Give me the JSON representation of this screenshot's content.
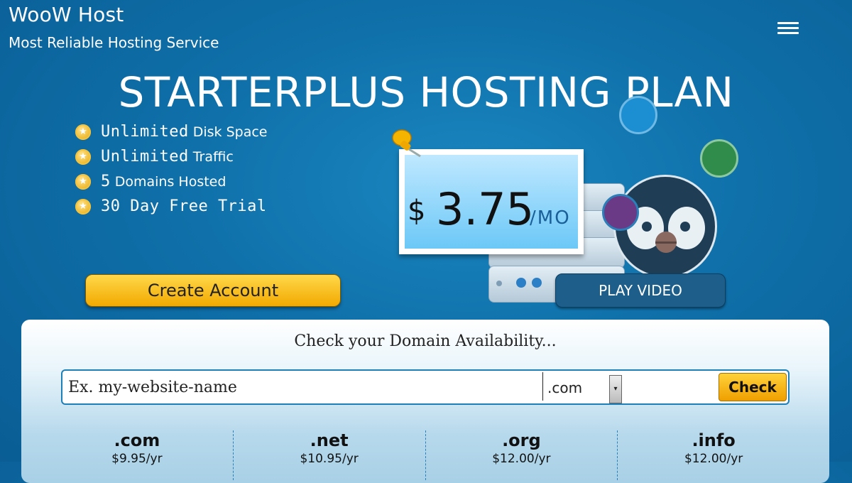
{
  "header": {
    "brand": "WooW Host",
    "tagline": "Most Reliable Hosting Service"
  },
  "hero": {
    "headline": "STARTERPLUS HOSTING PLAN",
    "features": [
      {
        "strong": "Unlimited",
        "rest": "Disk Space"
      },
      {
        "strong": "Unlimited",
        "rest": "Traffic"
      },
      {
        "strong": "5",
        "rest": "Domains Hosted"
      },
      {
        "strong": "30 Day Free Trial",
        "rest": ""
      }
    ],
    "create_label": "Create Account",
    "price": {
      "currency": "$",
      "amount": "3.75",
      "per": "/MO"
    },
    "play_label": "PLAY VIDEO"
  },
  "domain": {
    "title": "Check your Domain Availability...",
    "placeholder": "Ex. my-website-name",
    "tld_selected": ".com",
    "check_label": "Check",
    "tlds": [
      {
        "name": ".com",
        "price": "$9.95/yr"
      },
      {
        "name": ".net",
        "price": "$10.95/yr"
      },
      {
        "name": ".org",
        "price": "$12.00/yr"
      },
      {
        "name": ".info",
        "price": "$12.00/yr"
      }
    ]
  },
  "colors": {
    "background": "#0f6fa8",
    "button_yellow": "#f2a900",
    "play_button": "#1d5f8a"
  },
  "icons": {
    "menu": "hamburger-menu-icon",
    "feature": "star-icon",
    "pin": "pushpin-icon"
  }
}
